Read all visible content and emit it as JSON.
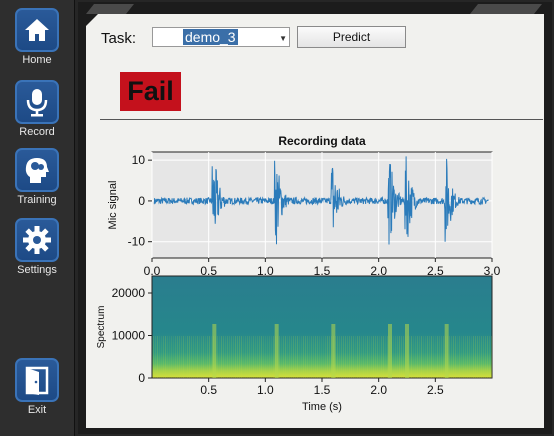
{
  "sidebar": {
    "items": [
      {
        "label": "Home",
        "icon": "home-icon"
      },
      {
        "label": "Record",
        "icon": "microphone-icon"
      },
      {
        "label": "Training",
        "icon": "brain-head-icon"
      },
      {
        "label": "Settings",
        "icon": "gear-icon"
      },
      {
        "label": "Exit",
        "icon": "exit-door-icon"
      }
    ]
  },
  "task": {
    "label": "Task:",
    "selected": "demo_3"
  },
  "predict_label": "Predict",
  "result": "Fail",
  "colors": {
    "accent": "#3a73b8",
    "fail": "#c4111c",
    "signal": "#2b7bba"
  },
  "chart_data": [
    {
      "type": "line",
      "title": "Recording data",
      "ylabel": "Mic signal",
      "xlabel": "",
      "xlim": [
        0.0,
        3.0
      ],
      "ylim": [
        -14,
        12
      ],
      "xticks": [
        "0.0",
        "0.5",
        "1.0",
        "1.5",
        "2.0",
        "2.5",
        "3.0"
      ],
      "yticks": [
        "10",
        "0",
        "-10"
      ],
      "grid": true,
      "series": [
        {
          "bursts_at_s": [
            0.55,
            1.1,
            1.6,
            2.1,
            2.25,
            2.6
          ]
        }
      ]
    },
    {
      "type": "heatmap",
      "title": "",
      "ylabel": "Spectrum",
      "xlabel": "Time (s)",
      "xlim": [
        0.0,
        3.0
      ],
      "ylim": [
        0,
        24000
      ],
      "xticks": [
        "0.5",
        "1.0",
        "1.5",
        "2.0",
        "2.5"
      ],
      "yticks": [
        "20000",
        "10000",
        "0"
      ]
    }
  ]
}
